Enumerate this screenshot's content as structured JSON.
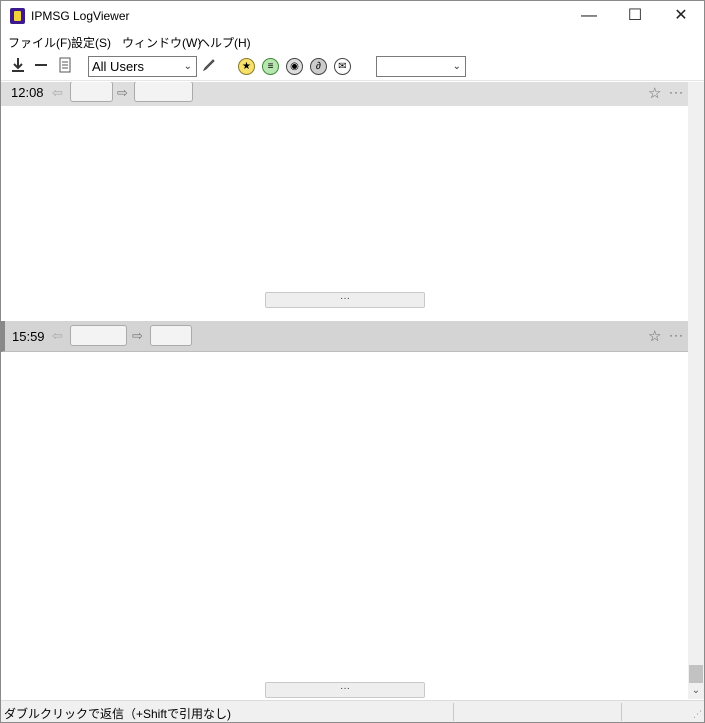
{
  "window": {
    "title": "IPMSG LogViewer",
    "controls": {
      "minimize": "—",
      "maximize": "☐",
      "close": "✕"
    }
  },
  "menu": {
    "items": [
      "ファイル(F)",
      "設定(S)",
      "ウィンドウ(W)",
      "ヘルプ(H)"
    ]
  },
  "toolbar": {
    "user_filter": {
      "selected": "All Users"
    },
    "search_combo": {
      "value": ""
    },
    "icons": [
      "download-icon",
      "collapse-icon",
      "memo-icon",
      "edit-pencil-icon",
      "star-filter-icon",
      "comment-filter-icon",
      "image-filter-icon",
      "attachment-filter-icon",
      "mail-filter-icon"
    ]
  },
  "entries": [
    {
      "time": "12:08",
      "expand_label": "···",
      "more_label": "···",
      "star": "☆",
      "prev_arrow": "⇦",
      "next_arrow": "⇨"
    },
    {
      "time": "15:59",
      "expand_label": "···",
      "more_label": "···",
      "star": "☆",
      "prev_arrow": "⇦",
      "next_arrow": "⇨"
    }
  ],
  "status": {
    "text": "ダブルクリックで返信（+Shiftで引用なし)"
  }
}
